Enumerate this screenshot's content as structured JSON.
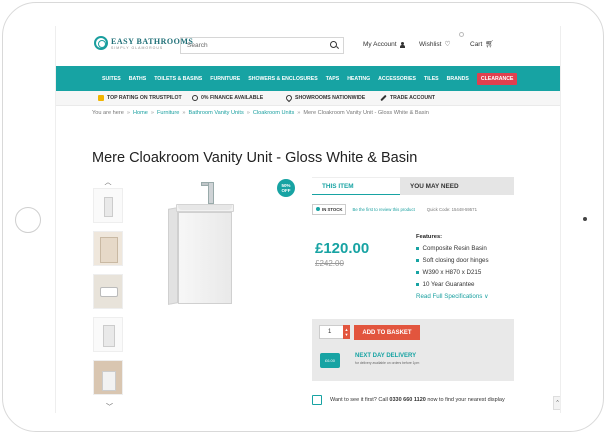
{
  "header": {
    "logo_main": "EASY BATHROOMS",
    "logo_sub": "SIMPLY GLAMOROUS",
    "search_placeholder": "Search",
    "account": "My Account",
    "wishlist": "Wishlist",
    "cart": "Cart"
  },
  "nav": {
    "items": [
      "SUITES",
      "BATHS",
      "TOILETS & BASINS",
      "FURNITURE",
      "SHOWERS & ENCLOSURES",
      "TAPS",
      "HEATING",
      "ACCESSORIES",
      "TILES",
      "BRANDS"
    ],
    "clearance": "CLEARANCE",
    "accent": "#17a3a3",
    "clearance_color": "#e0404f"
  },
  "usp": [
    "TOP RATING ON TRUSTPILOT",
    "0% FINANCE AVAILABLE",
    "SHOWROOMS NATIONWIDE",
    "TRADE ACCOUNT"
  ],
  "breadcrumb": {
    "prefix": "You are here",
    "links": [
      "Home",
      "Furniture",
      "Bathroom Vanity Units",
      "Cloakroom Units"
    ],
    "current": "Mere Cloakroom Vanity Unit - Gloss White & Basin"
  },
  "product": {
    "title": "Mere Cloakroom Vanity Unit - Gloss White & Basin",
    "sale_badge_pct": "50%",
    "sale_badge_off": "OFF",
    "price": "£120.00",
    "was_price": "£242.00",
    "stock": "IN STOCK",
    "review_link": "Be the first to review this product",
    "quick_code": "Quick Code: 15448-59571"
  },
  "tabs": [
    "THIS ITEM",
    "YOU MAY NEED"
  ],
  "features": {
    "heading": "Features:",
    "items": [
      "Composite Resin Basin",
      "Soft closing door hinges",
      "W390 x H870 x D215",
      "10 Year Guarantee"
    ],
    "specs_link": "Read Full Specifications ∨"
  },
  "basket": {
    "qty": "1",
    "add_label": "ADD TO BASKET",
    "truck_label": "£6.00",
    "delivery_title": "NEXT DAY DELIVERY",
    "delivery_sub": "for delivery available on orders before 1pm"
  },
  "showroom": {
    "text_before": "Want to see it first? Call",
    "phone": "0330 660 1120",
    "text_after": "now to find your nearest display"
  }
}
